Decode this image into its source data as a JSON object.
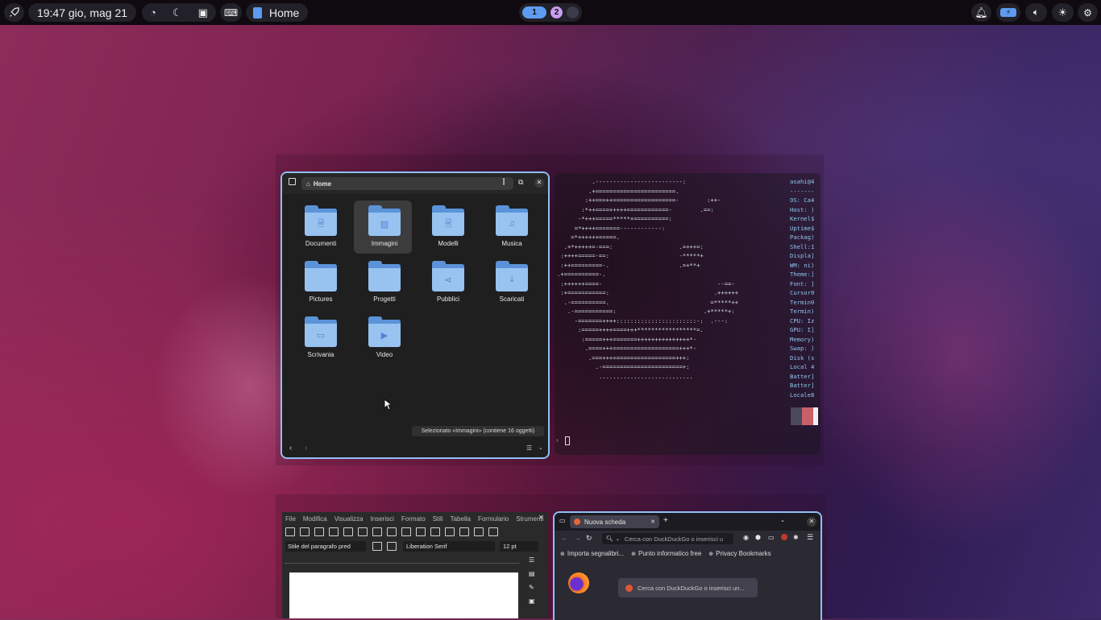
{
  "topbar": {
    "clock": "19:47 gio, mag 21",
    "active_app": "Home",
    "workspaces": [
      "1",
      "2"
    ],
    "colors": {
      "ws1": "#5e9bf0",
      "ws2": "#c89cf0",
      "ws3": "#3a3a4a"
    }
  },
  "file_manager": {
    "location": "Home",
    "folders": [
      {
        "label": "Documenti",
        "icon": "document-icon"
      },
      {
        "label": "Immagini",
        "icon": "image-icon"
      },
      {
        "label": "Modelli",
        "icon": "template-icon"
      },
      {
        "label": "Musica",
        "icon": "music-icon"
      },
      {
        "label": "Pictures",
        "icon": "none"
      },
      {
        "label": "Progetti",
        "icon": "none"
      },
      {
        "label": "Pubblici",
        "icon": "share-icon"
      },
      {
        "label": "Scaricati",
        "icon": "download-icon"
      },
      {
        "label": "Scrivania",
        "icon": "folder-icon"
      },
      {
        "label": "Video",
        "icon": "video-icon"
      }
    ],
    "status": "Selezionato «Immagini» (contiene 16 oggetti)"
  },
  "terminal": {
    "art": [
      "          .-------------------------:",
      "         .+=======================.",
      "        :++===++==================-        :++-",
      "       :*++====+++++============-        .==:",
      "      -*+++=====*****+==========:",
      "     =*++++=======------------:",
      "    =*++++++=====.",
      "  .+*+++++=-===:                   .=+++=:",
      " :++++=====-==:                    -*****+",
      " :++=========-.                    .=+**+",
      ".+==========-.",
      " :++++++====-                                 --==-",
      " :+===========:                              .++++++",
      "  .-==========.                             =*****++",
      "   .-===========:                         .+*****+:",
      "     -=======++++:::::::::::::::::::::::-:  .---:",
      "      :=====++++====+++*****************=.",
      "       :=====+++=======+++++++++++++++*-",
      "        .====+++===================+++*-",
      "         .===+++==================+++:",
      "           .-=======================+:",
      "            ..........................."
    ],
    "info": [
      "asahi@4",
      "-------",
      "OS: Ca4",
      "Host: )",
      "Kernel$",
      "Uptime$",
      "Packag)",
      "Shell:1",
      "Displa]",
      "WM: ni)",
      "Theme:]",
      "Font: ]",
      "Cursor0",
      "Termin0",
      "Termin)",
      "CPU: Iz",
      "GPU: I]",
      "Memory)",
      "Swap: )",
      "Disk (s",
      "Local 4",
      "Batter]",
      "Batter]",
      "Locale8"
    ],
    "swatches": [
      "#4a4a5a",
      "#c96068",
      "#f0f0f0"
    ]
  },
  "writer": {
    "menu": [
      "File",
      "Modifica",
      "Visualizza",
      "Inserisci",
      "Formato",
      "Stili",
      "Tabella",
      "Formulario",
      "Strumenti"
    ],
    "paragraph_style": "Stile del paragrafo pred",
    "font_name": "Liberation Serif",
    "font_size": "12 pt"
  },
  "firefox": {
    "tab_title": "Nuova scheda",
    "url_placeholder": "Cerca con DuckDuckGo o inserisci u",
    "bookmarks": [
      "Importa segnalibri...",
      "Punto informatico free",
      "Privacy Bookmarks"
    ],
    "search_placeholder": "Cerca con DuckDuckGo o inserisci un..."
  }
}
